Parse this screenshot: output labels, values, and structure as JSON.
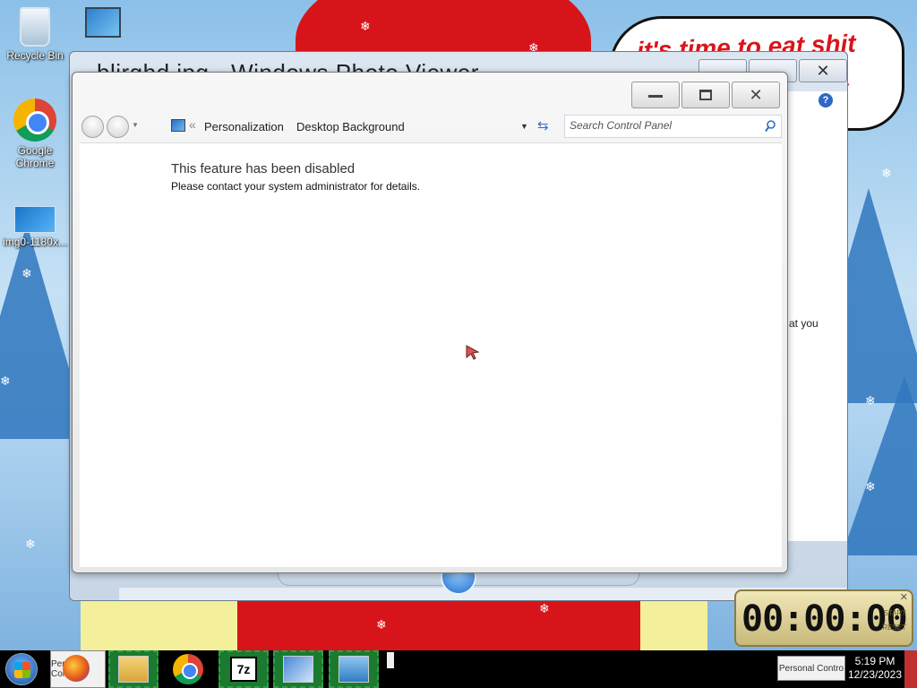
{
  "desktop": {
    "icons": [
      {
        "label": "Recycle Bin",
        "icon": "recycle-bin-icon"
      },
      {
        "label": "",
        "icon": "shortcut-monitor-icon"
      },
      {
        "label": "Google Chrome",
        "icon": "chrome-icon"
      },
      {
        "label": "img0-1180x...",
        "icon": "image-file-icon"
      }
    ],
    "speech_bubble": {
      "line1": "it's time to eat shit",
      "line2": "y"
    }
  },
  "photo_viewer": {
    "title": "blirghd.jpg - Windows Photo Viewer",
    "fragment_text": "at you",
    "help_label": "?"
  },
  "control_panel": {
    "buttons": {
      "minimize": "",
      "maximize": "",
      "close": "✕"
    },
    "breadcrumb": {
      "separator": "«",
      "items": [
        "Personalization",
        "Desktop Background"
      ]
    },
    "search": {
      "placeholder": "Search Control Panel"
    },
    "message": {
      "title": "This feature has been disabled",
      "body": "Please contact your system administrator for details."
    }
  },
  "gadget": {
    "time": "00:00:00",
    "start": "START",
    "reset": "RESET",
    "close": "✕"
  },
  "taskbar": {
    "items": [
      {
        "name": "firefox",
        "label": "Personal Cont"
      },
      {
        "name": "file-explorer",
        "label": ""
      },
      {
        "name": "chrome",
        "label": ""
      },
      {
        "name": "7zip",
        "label": "7z"
      },
      {
        "name": "control-panel",
        "label": ""
      },
      {
        "name": "photo-viewer",
        "label": ""
      }
    ],
    "tray_ghost_label": "Personal Contro",
    "clock": {
      "time": "5:19 PM",
      "date": "12/23/2023"
    }
  },
  "colors": {
    "accent": "#2f6fd1",
    "bubble_text": "#d9141b",
    "taskbar": "#000000"
  }
}
